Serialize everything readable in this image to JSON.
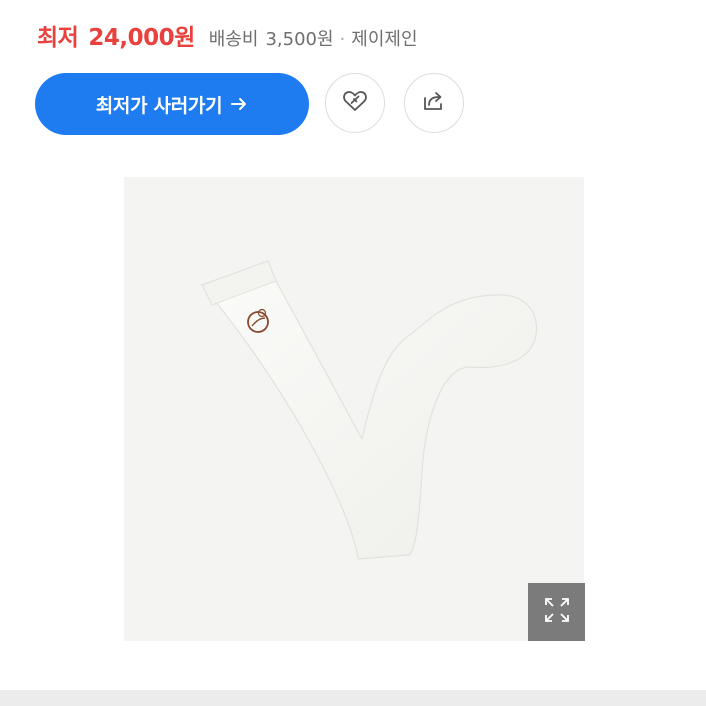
{
  "price": {
    "label": "최저",
    "value": "24,000원",
    "shipping_label": "배송비",
    "shipping_value": "3,500원",
    "separator": "·",
    "seller": "제이제인"
  },
  "actions": {
    "buy_label": "최저가 사러가기",
    "buy_arrow_icon": "arrow-right-icon",
    "wish_icon": "heart-link-icon",
    "share_icon": "share-icon"
  },
  "image": {
    "subject": "white knee-high sock with brown embroidered logo",
    "expand_icon": "expand-icon"
  },
  "colors": {
    "price": "#e8413e",
    "primary": "#1f7cf0",
    "muted_text": "#6f6f6f"
  }
}
